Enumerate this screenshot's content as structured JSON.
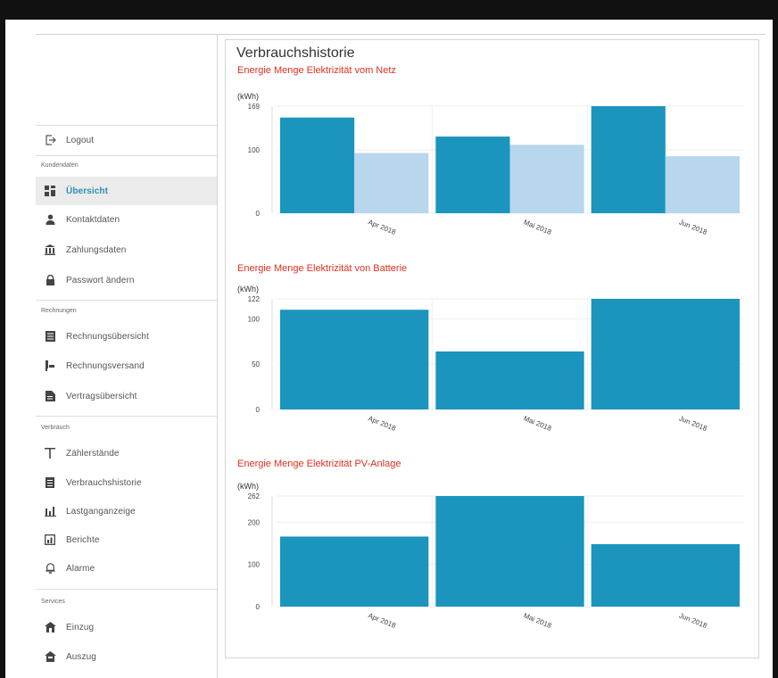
{
  "colors": {
    "accent": "#2a8fb3",
    "bar_primary": "#1b95bd",
    "bar_secondary": "#b8d6ec",
    "chart_title": "#e0301e"
  },
  "sidebar": {
    "logout": {
      "label": "Logout",
      "icon": "logout-icon"
    },
    "sections": [
      {
        "label": "Kundendaten",
        "items": [
          {
            "label": "Übersicht",
            "icon": "dashboard-icon",
            "active": true
          },
          {
            "label": "Kontaktdaten",
            "icon": "user-icon"
          },
          {
            "label": "Zahlungsdaten",
            "icon": "bank-icon"
          },
          {
            "label": "Passwort ändern",
            "icon": "lock-icon"
          }
        ]
      },
      {
        "label": "Rechnungen",
        "items": [
          {
            "label": "Rechnungsübersicht",
            "icon": "invoice-icon"
          },
          {
            "label": "Rechnungsversand",
            "icon": "send-icon"
          },
          {
            "label": "Vertragsübersicht",
            "icon": "contract-icon"
          }
        ]
      },
      {
        "label": "Verbrauch",
        "items": [
          {
            "label": "Zählerstände",
            "icon": "meter-icon"
          },
          {
            "label": "Verbrauchshistorie",
            "icon": "history-icon"
          },
          {
            "label": "Lastganganzeige",
            "icon": "bar-chart-icon"
          },
          {
            "label": "Berichte",
            "icon": "report-icon"
          },
          {
            "label": "Alarme",
            "icon": "alarm-icon"
          }
        ]
      },
      {
        "label": "Services",
        "items": [
          {
            "label": "Einzug",
            "icon": "move-in-icon"
          },
          {
            "label": "Auszug",
            "icon": "move-out-icon"
          }
        ]
      }
    ]
  },
  "main": {
    "title": "Verbrauchshistorie"
  },
  "chart_data": [
    {
      "type": "bar",
      "title": "Energie Menge Elektrizität vom Netz",
      "ylabel": "(kWh)",
      "categories": [
        "Apr 2018",
        "Mai 2018",
        "Jun 2018"
      ],
      "series": [
        {
          "values": [
            151,
            121,
            169
          ]
        },
        {
          "values": [
            95,
            108,
            90
          ]
        }
      ],
      "ylim": [
        0,
        169
      ],
      "yticks": [
        "0",
        "100",
        "169"
      ],
      "ytick_values": [
        0,
        100,
        169
      ]
    },
    {
      "type": "bar",
      "title": "Energie Menge Elektrizität von Batterie",
      "ylabel": "(kWh)",
      "categories": [
        "Apr 2018",
        "Mai 2018",
        "Jun 2018"
      ],
      "series": [
        {
          "values": [
            110,
            64,
            122
          ]
        }
      ],
      "ylim": [
        0,
        122
      ],
      "yticks": [
        "0",
        "50",
        "100",
        "122"
      ],
      "ytick_values": [
        0,
        50,
        100,
        122
      ]
    },
    {
      "type": "bar",
      "title": "Energie Menge Elektrizität PV-Anlage",
      "ylabel": "(kWh)",
      "categories": [
        "Apr 2018",
        "Mai 2018",
        "Jun 2018"
      ],
      "series": [
        {
          "values": [
            166,
            262,
            148
          ]
        }
      ],
      "ylim": [
        0,
        262
      ],
      "yticks": [
        "0",
        "100",
        "200",
        "262"
      ],
      "ytick_values": [
        0,
        100,
        200,
        262
      ]
    }
  ]
}
